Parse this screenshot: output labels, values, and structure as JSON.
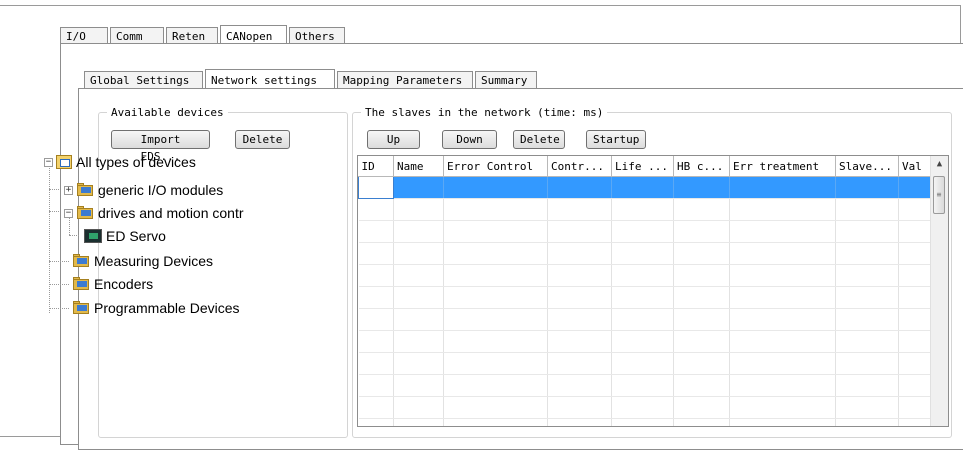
{
  "top_tabs": [
    "I/O",
    "Comm",
    "Reten",
    "CANopen",
    "Others"
  ],
  "top_active": "CANopen",
  "sub_tabs": [
    "Global Settings",
    "Network settings",
    "Mapping Parameters",
    "Summary"
  ],
  "sub_active": "Network settings",
  "available_devices": {
    "title": "Available devices",
    "import_label": "Import EDS...",
    "delete_label": "Delete",
    "tree": {
      "root": "All types of devices",
      "generic": "generic I/O modules",
      "drives": "drives and motion contr",
      "ed_servo": "ED Servo",
      "measuring": "Measuring Devices",
      "encoders": "Encoders",
      "programmable": "Programmable Devices"
    }
  },
  "slaves": {
    "title": "The slaves in the network (time: ms)",
    "up_label": "Up",
    "down_label": "Down",
    "delete_label": "Delete",
    "startup_label": "Startup",
    "columns": [
      "ID",
      "Name",
      "Error Control",
      "Contr...",
      "Life ...",
      "HB c...",
      "Err treatment",
      "Slave...",
      "Val"
    ]
  },
  "colors": {
    "selection": "#3399ff",
    "frame": "#8d8d8d"
  },
  "icons": [
    "folder-icon",
    "device-icon",
    "expand-plus-icon",
    "collapse-minus-icon",
    "scroll-up-arrow-icon"
  ]
}
